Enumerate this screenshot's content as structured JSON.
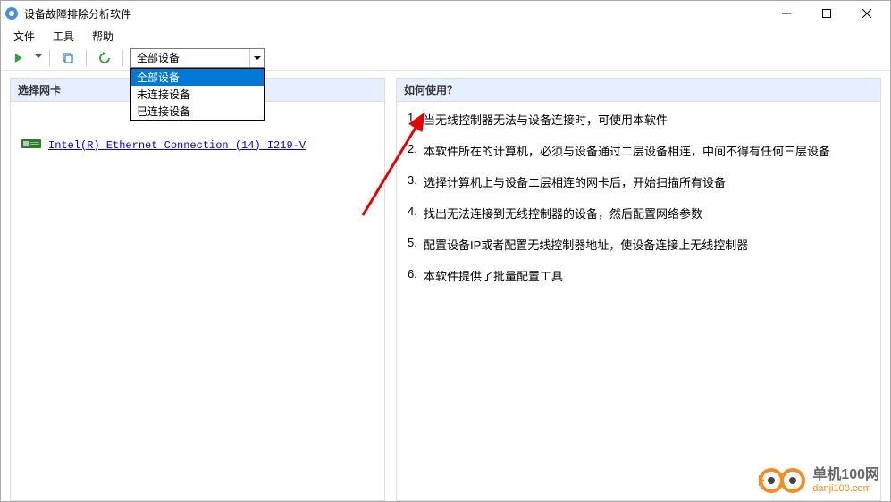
{
  "window": {
    "title": "设备故障排除分析软件"
  },
  "menu": {
    "file": "文件",
    "tools": "工具",
    "help": "帮助"
  },
  "toolbar": {
    "combo_value": "全部设备",
    "combo_options": {
      "all": "全部设备",
      "disconnected": "未连接设备",
      "connected": "已连接设备"
    }
  },
  "left": {
    "header": "选择网卡",
    "nic_name": "Intel(R) Ethernet Connection (14) I219-V"
  },
  "right": {
    "header": "如何使用？",
    "steps": {
      "s1": "当无线控制器无法与设备连接时，可使用本软件",
      "s2": "本软件所在的计算机，必须与设备通过二层设备相连，中间不得有任何三层设备",
      "s3": "选择计算机上与设备二层相连的网卡后，开始扫描所有设备",
      "s4": "找出无法连接到无线控制器的设备，然后配置网络参数",
      "s5": "配置设备IP或者配置无线控制器地址，使设备连接上无线控制器",
      "s6": "本软件提供了批量配置工具"
    }
  },
  "watermark": {
    "line1": "单机100网",
    "line2": "danji100.com"
  }
}
